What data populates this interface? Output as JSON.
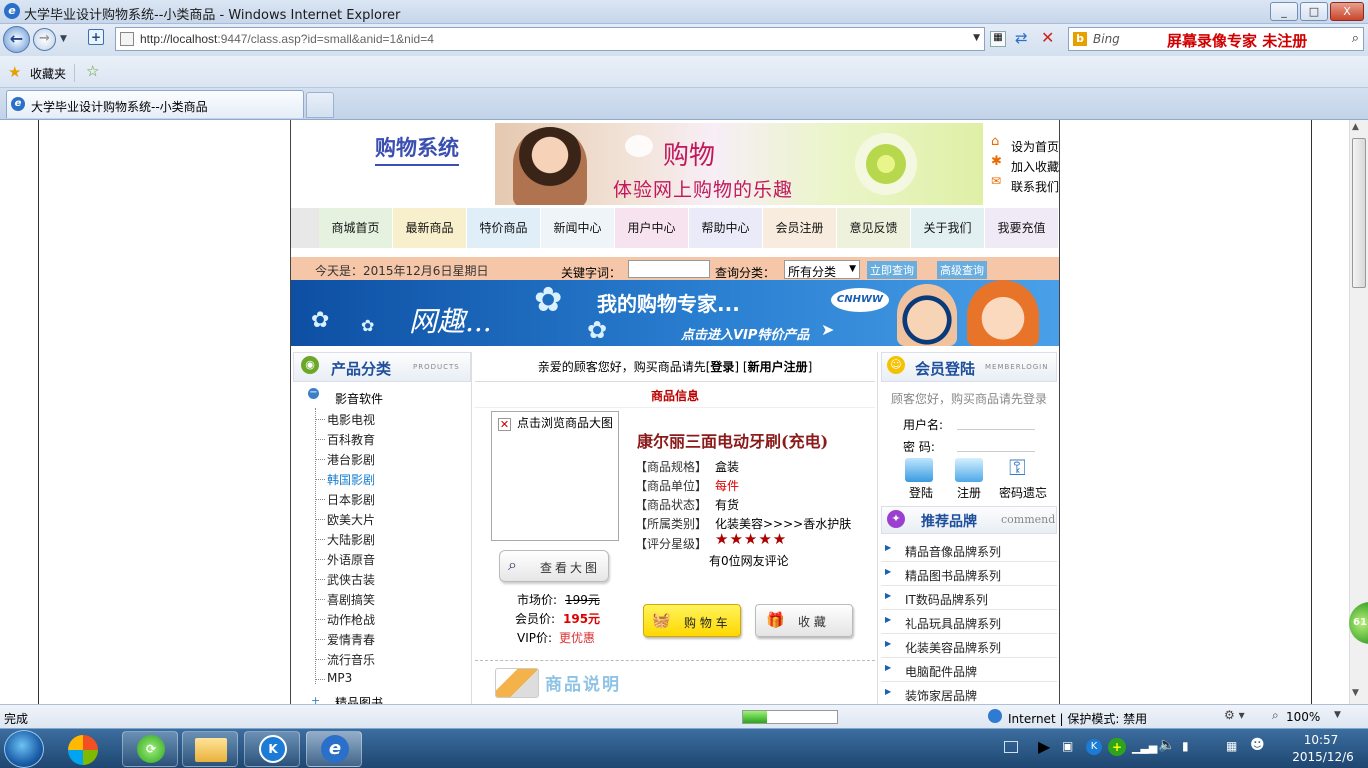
{
  "window": {
    "title": "大学毕业设计购物系统--小类商品 - Windows Internet Explorer",
    "min": "_",
    "max": "□",
    "close": "X"
  },
  "browser": {
    "url_host": "http://localhost",
    "url_rest": ":9447/class.asp?id=small&anid=1&nid=4",
    "search_placeholder": "Bing",
    "recorder_text": "屏幕录像专家  未注册",
    "favorites_label": "收藏夹",
    "tab_title": "大学毕业设计购物系统--小类商品"
  },
  "site": {
    "logo_text": "购物系统",
    "banner_title": "购物",
    "banner_sub": "体验网上购物的乐趣",
    "top_links": [
      "设为首页",
      "加入收藏",
      "联系我们"
    ],
    "nav": [
      "商城首页",
      "最新商品",
      "特价商品",
      "新闻中心",
      "用户中心",
      "帮助中心",
      "会员注册",
      "意见反馈",
      "关于我们",
      "我要充值"
    ],
    "date_text": "今天是：2015年12月6日星期日",
    "keyword_label": "关键字词：",
    "category_label": "查询分类：",
    "category_value": "所有分类",
    "search_btn": "立即查询",
    "adv_btn": "高级查询",
    "promo_title": "我的购物专家...",
    "promo_left": "网趣...",
    "promo_sub": "点击进入VIP特价产品",
    "promo_badge": "CNHWW"
  },
  "left": {
    "title": "产品分类",
    "title_en": "PRODUCTS",
    "group": "影音软件",
    "items": [
      "电影电视",
      "百科教育",
      "港台影剧",
      "韩国影剧",
      "日本影剧",
      "欧美大片",
      "大陆影剧",
      "外语原音",
      "武侠古装",
      "喜剧搞笑",
      "动作枪战",
      "爱情青春",
      "流行音乐",
      "MP3"
    ],
    "next_group": "精品图书",
    "active_index": 3
  },
  "center": {
    "notice_pre": "亲爱的顾客您好，购买商品请先[",
    "login": "登录",
    "notice_mid": "] [",
    "register": "新用户注册",
    "notice_post": "]",
    "section_title": "商品信息",
    "img_alt": "点击浏览商品大图",
    "view_big": "查看大图",
    "product_name": "康尔丽三面电动牙刷(充电)",
    "spec_label": "【商品规格】",
    "spec_value": "盒装",
    "unit_label": "【商品单位】",
    "unit_value": "每件",
    "status_label": "【商品状态】",
    "status_value": "有货",
    "cat_label": "【所属类别】",
    "cat_value": "化装美容>>>>香水护肤",
    "rating_label": "【评分星级】",
    "rating_stars": "★★★★★",
    "rating_count": 5,
    "reviews": "有0位网友评论",
    "market_label": "市场价:",
    "market_price": "199元",
    "member_label": "会员价:",
    "member_price": "195元",
    "vip_label": "VIP价:",
    "vip_price": "更优惠",
    "cart_btn": "购 物 车",
    "fav_btn": "收  藏",
    "desc_title": "商品说明"
  },
  "right": {
    "title": "会员登陆",
    "title_en": "MEMBERLOGIN",
    "hint": "顾客您好，购买商品请先登录",
    "user_label": "用户名:",
    "pass_label": "密  码:",
    "login_btn": "登陆",
    "reg_btn": "注册",
    "forgot_btn": "密码遗忘",
    "brand_title": "推荐品牌",
    "brand_en": "commend",
    "brands": [
      "精品音像品牌系列",
      "精品图书品牌系列",
      "IT数码品牌系列",
      "礼品玩具品牌系列",
      "化装美容品牌系列",
      "电脑配件品牌",
      "装饰家居品牌"
    ]
  },
  "status": {
    "text": "完成",
    "zone": "Internet | 保护模式: 禁用",
    "zoom": "100%",
    "progress": 0.25
  },
  "taskbar": {
    "time": "10:57",
    "date": "2015/12/6",
    "float_badge": "61"
  }
}
